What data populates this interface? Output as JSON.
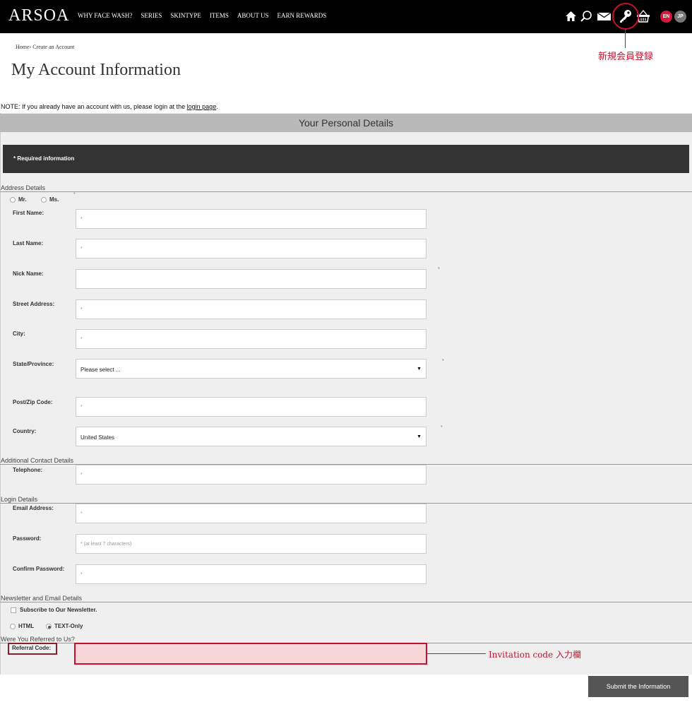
{
  "header": {
    "logo": "ARSOA",
    "nav": [
      "WHY FACE WASH?",
      "SERIES",
      "SKINTYPE",
      "ITEMS",
      "ABOUT US",
      "EARN REWARDS"
    ],
    "lang_en": "EN",
    "lang_jp": "JP",
    "key_annotation": "新規会員登録"
  },
  "breadcrumb": "Home› Create an Account",
  "page_title": "My Account Information",
  "note": {
    "text": "NOTE: If you already have an account with us, please login at the ",
    "link": "login page",
    "end": "."
  },
  "section_title": "Your Personal Details",
  "required_info": "* Required information",
  "sections": {
    "address": "Address Details",
    "contact": "Additional Contact Details",
    "login": "Login Details",
    "newsletter": "Newsletter and Email Details",
    "referral": "Were You Referred to Us?"
  },
  "gender": {
    "mr": "Mr.",
    "ms": "Ms."
  },
  "fields": {
    "first_name": {
      "label": "First Name:",
      "placeholder": "*"
    },
    "last_name": {
      "label": "Last Name:",
      "placeholder": "*"
    },
    "nick_name": {
      "label": "Nick Name:",
      "placeholder": ""
    },
    "street": {
      "label": "Street Address:",
      "placeholder": "*"
    },
    "city": {
      "label": "City:",
      "placeholder": "*"
    },
    "state": {
      "label": "State/Province:",
      "value": "Please select ..."
    },
    "zip": {
      "label": "Post/Zip Code:",
      "placeholder": "*"
    },
    "country": {
      "label": "Country:",
      "value": "United States"
    },
    "telephone": {
      "label": "Telephone:",
      "placeholder": "*"
    },
    "email": {
      "label": "Email Address:",
      "placeholder": "*"
    },
    "password": {
      "label": "Password:",
      "placeholder": "* (at least 7 characters)"
    },
    "confirm_password": {
      "label": "Confirm Password:",
      "placeholder": "*"
    },
    "referral": {
      "label": "Referral Code:",
      "annotation": "Invitation code 入力欄"
    }
  },
  "asterisk": "*",
  "newsletter": {
    "subscribe": "Subscribe to Our Newsletter.",
    "html": "HTML",
    "text_only": "TEXT-Only",
    "selected": "TEXT-Only"
  },
  "submit_label": "Submit the Information",
  "colors": {
    "accent": "#c8102e",
    "header_bg": "#000000",
    "section_bar": "#b9b9b9"
  }
}
